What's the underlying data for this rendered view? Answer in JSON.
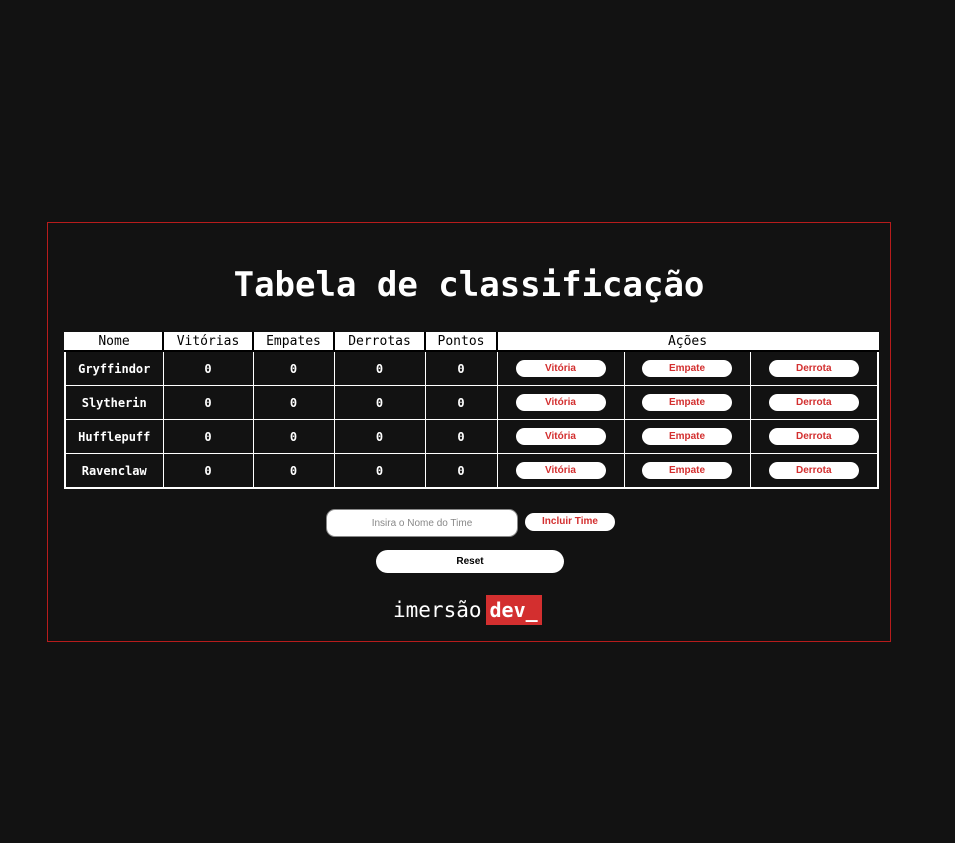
{
  "title": "Tabela de classificação",
  "columns": {
    "name": "Nome",
    "wins": "Vitórias",
    "draws": "Empates",
    "losses": "Derrotas",
    "points": "Pontos",
    "actions": "Ações"
  },
  "teams": [
    {
      "name": "Gryffindor",
      "wins": "0",
      "draws": "0",
      "losses": "0",
      "points": "0"
    },
    {
      "name": "Slytherin",
      "wins": "0",
      "draws": "0",
      "losses": "0",
      "points": "0"
    },
    {
      "name": "Hufflepuff",
      "wins": "0",
      "draws": "0",
      "losses": "0",
      "points": "0"
    },
    {
      "name": "Ravenclaw",
      "wins": "0",
      "draws": "0",
      "losses": "0",
      "points": "0"
    }
  ],
  "actions": {
    "win": "Vitória",
    "draw": "Empate",
    "loss": "Derrota"
  },
  "form": {
    "placeholder": "Insira o Nome do Time",
    "value": "",
    "add_label": "Incluir Time",
    "reset_label": "Reset"
  },
  "logo": {
    "light": "imersão",
    "box": "dev_"
  },
  "colors": {
    "background": "#121212",
    "accent": "#d32f2f",
    "panel_border": "#b71c1c",
    "text": "#ffffff"
  }
}
